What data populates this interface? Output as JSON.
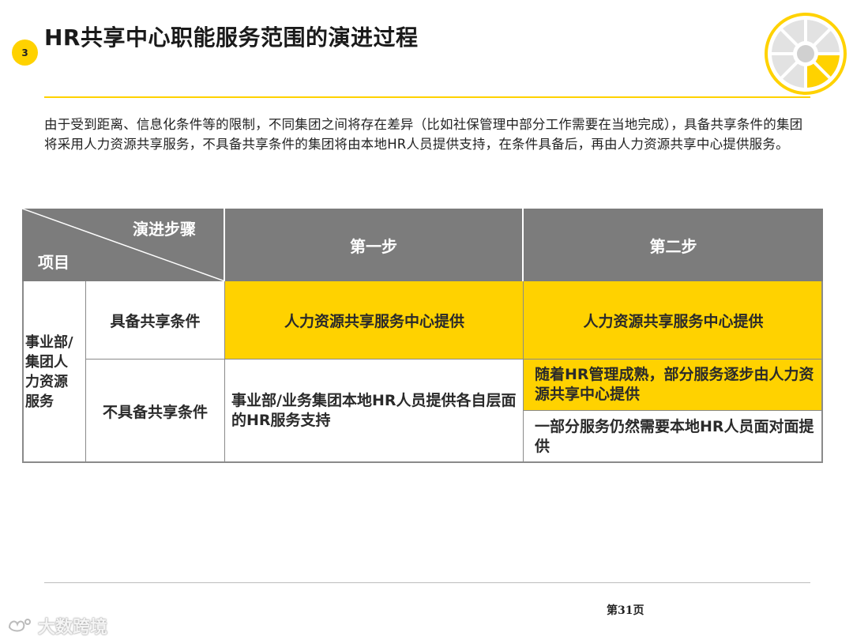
{
  "slide": {
    "section_number": "3",
    "title": "HR共享中心职能服务范围的演进过程",
    "intro": "由于受到距离、信息化条件等的限制，不同集团之间将存在差异（比如社保管理中部分工作需要在当地完成），具备共享条件的集团将采用人力资源共享服务，不具备共享条件的集团将由本地HR人员提供支持，在条件具备后，再由人力资源共享中心提供服务。",
    "page_number": "第31页",
    "watermark": "大数跨境",
    "colors": {
      "accent": "#ffd200",
      "header_gray": "#7c7c7c"
    }
  },
  "table": {
    "corner_top": "演进步骤",
    "corner_bottom": "项目",
    "col_step1": "第一步",
    "col_step2": "第二步",
    "row_group": "事业部/集团人力资源服务",
    "row1_label": "具备共享条件",
    "row1_step1": "人力资源共享服务中心提供",
    "row1_step2": "人力资源共享服务中心提供",
    "row2_label": "不具备共享条件",
    "row2_step1": "事业部/业务集团本地HR人员提供各自层面的HR服务支持",
    "row2_step2a": "随着HR管理成熟，部分服务逐步由人力资源共享中心提供",
    "row2_step2b": "一部分服务仍然需要本地HR人员面对面提供"
  }
}
